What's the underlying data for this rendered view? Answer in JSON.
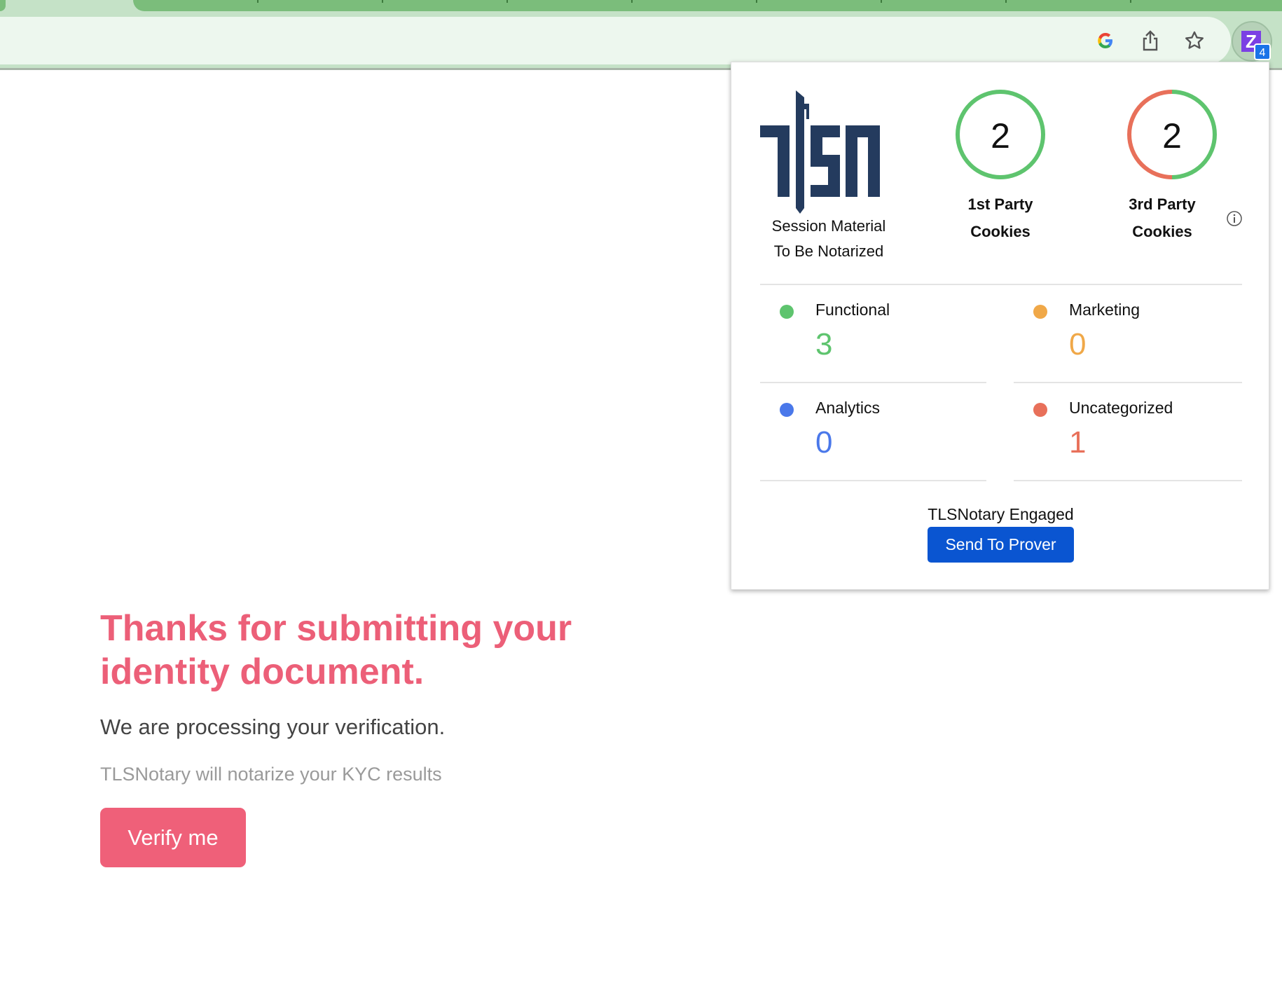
{
  "browser": {
    "extension_badge": "4",
    "extension_letter": "Z",
    "icons": [
      "google-icon",
      "share-icon",
      "star-icon",
      "extension-icon"
    ]
  },
  "popup": {
    "logo_text": "TLSN",
    "logo_caption_1": "Session Material",
    "logo_caption_2": "To Be Notarized",
    "first_party": {
      "count": "2",
      "label_1": "1st Party",
      "label_2": "Cookies"
    },
    "third_party": {
      "count": "2",
      "label_1": "3rd Party",
      "label_2": "Cookies"
    },
    "categories": [
      {
        "label": "Functional",
        "count": "3",
        "color": "#5ec46e"
      },
      {
        "label": "Marketing",
        "count": "0",
        "color": "#f0a848"
      },
      {
        "label": "Analytics",
        "count": "0",
        "color": "#4a78ea"
      },
      {
        "label": "Uncategorized",
        "count": "1",
        "color": "#e8705a"
      }
    ],
    "status": "TLSNotary Engaged",
    "send_button": "Send To Prover"
  },
  "page": {
    "heading": "Thanks for submitting your identity document.",
    "subtitle": "We are processing your verification.",
    "note": "TLSNotary will notarize your KYC results",
    "verify_button": "Verify me",
    "accent": "#ec5f78"
  }
}
